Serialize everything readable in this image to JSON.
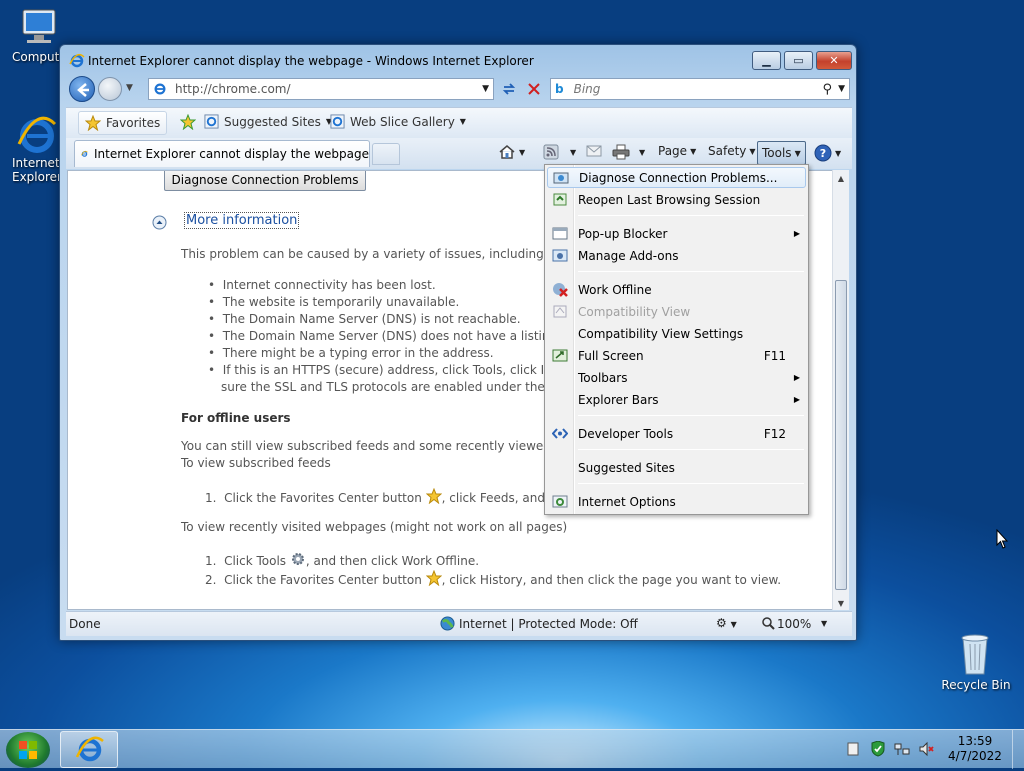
{
  "desktop": {
    "icons": [
      {
        "label": "Computer"
      },
      {
        "label": "Internet Explorer"
      },
      {
        "label": "Recycle Bin"
      }
    ]
  },
  "window": {
    "title": "Internet Explorer cannot display the webpage - Windows Internet Explorer",
    "address": "http://chrome.com/",
    "search_placeholder": "Bing"
  },
  "favorites_bar": {
    "favorites": "Favorites",
    "suggested_sites": "Suggested Sites",
    "web_slice_gallery": "Web Slice Gallery"
  },
  "tab": {
    "label": "Internet Explorer cannot display the webpage"
  },
  "command_bar": {
    "page": "Page",
    "safety": "Safety",
    "tools": "Tools"
  },
  "content": {
    "diagnose_button": "Diagnose Connection Problems",
    "more_information": "More information",
    "intro": "This problem can be caused by a variety of issues, including:",
    "bullets": [
      "Internet connectivity has been lost.",
      "The website is temporarily unavailable.",
      "The Domain Name Server (DNS) is not reachable.",
      "The Domain Name Server (DNS) does not have a listing f",
      "There might be a typing error in the address.",
      "If this is an HTTPS (secure) address, click Tools, click Inter",
      "sure the SSL and TLS protocols are enabled under the se"
    ],
    "offline_header": "For offline users",
    "offline_p1": "You can still view subscribed feeds and some recently viewed w",
    "offline_p2": "To view subscribed feeds",
    "feeds_step": "Click the Favorites Center button",
    "feeds_step_tail": ", click Feeds, and ther",
    "recent_intro": "To view recently visited webpages (might not work on all pages)",
    "recent_step1": "Click Tools",
    "recent_step1_tail": ", and then click Work Offline.",
    "recent_step2": "Click the Favorites Center button",
    "recent_step2_tail": ", click History, and then click the page you want to view.",
    "num1": "1.",
    "num2": "2."
  },
  "tools_menu": {
    "items": [
      {
        "label": "Diagnose Connection Problems...",
        "shortcut": ""
      },
      {
        "label": "Reopen Last Browsing Session",
        "shortcut": ""
      },
      {
        "label": "Pop-up Blocker",
        "shortcut": ""
      },
      {
        "label": "Manage Add-ons",
        "shortcut": ""
      },
      {
        "label": "Work Offline",
        "shortcut": ""
      },
      {
        "label": "Compatibility View",
        "shortcut": ""
      },
      {
        "label": "Compatibility View Settings",
        "shortcut": ""
      },
      {
        "label": "Full Screen",
        "shortcut": "F11"
      },
      {
        "label": "Toolbars",
        "shortcut": ""
      },
      {
        "label": "Explorer Bars",
        "shortcut": ""
      },
      {
        "label": "Developer Tools",
        "shortcut": "F12"
      },
      {
        "label": "Suggested Sites",
        "shortcut": ""
      },
      {
        "label": "Internet Options",
        "shortcut": ""
      }
    ]
  },
  "status_bar": {
    "left": "Done",
    "zone": "Internet | Protected Mode: Off",
    "zoom": "100%"
  },
  "taskbar": {
    "time": "13:59",
    "date": "4/7/2022"
  }
}
